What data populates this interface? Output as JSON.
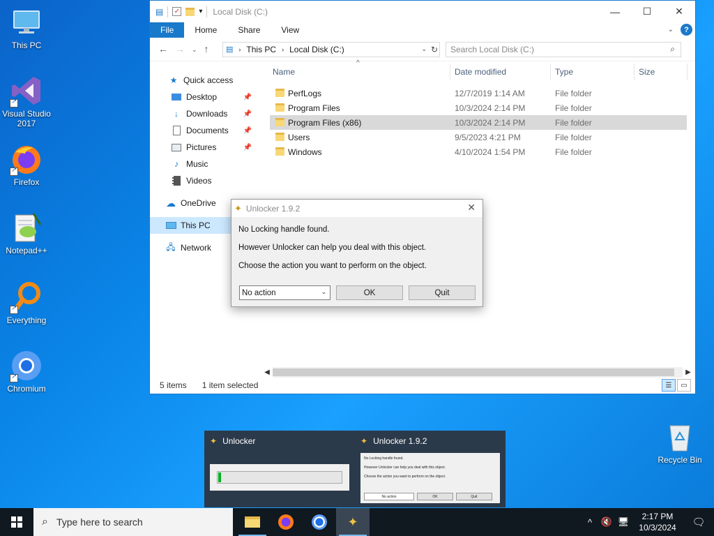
{
  "desktop": {
    "icons": [
      {
        "label": "This PC"
      },
      {
        "label": "Visual Studio 2017"
      },
      {
        "label": "Firefox"
      },
      {
        "label": "Notepad++"
      },
      {
        "label": "Everything"
      },
      {
        "label": "Chromium"
      },
      {
        "label": "Recycle Bin"
      }
    ]
  },
  "explorer": {
    "title": "Local Disk (C:)",
    "ribbon": {
      "file": "File",
      "home": "Home",
      "share": "Share",
      "view": "View",
      "help": "?"
    },
    "address": {
      "root": "This PC",
      "current": "Local Disk (C:)"
    },
    "search_placeholder": "Search Local Disk (C:)",
    "nav": [
      {
        "label": "Quick access"
      },
      {
        "label": "Desktop"
      },
      {
        "label": "Downloads"
      },
      {
        "label": "Documents"
      },
      {
        "label": "Pictures"
      },
      {
        "label": "Music"
      },
      {
        "label": "Videos"
      },
      {
        "label": "OneDrive"
      },
      {
        "label": "This PC"
      },
      {
        "label": "Network"
      }
    ],
    "columns": {
      "name": "Name",
      "date": "Date modified",
      "type": "Type",
      "size": "Size"
    },
    "rows": [
      {
        "name": "PerfLogs",
        "date": "12/7/2019 1:14 AM",
        "type": "File folder"
      },
      {
        "name": "Program Files",
        "date": "10/3/2024 2:14 PM",
        "type": "File folder"
      },
      {
        "name": "Program Files (x86)",
        "date": "10/3/2024 2:14 PM",
        "type": "File folder"
      },
      {
        "name": "Users",
        "date": "9/5/2023 4:21 PM",
        "type": "File folder"
      },
      {
        "name": "Windows",
        "date": "4/10/2024 1:54 PM",
        "type": "File folder"
      }
    ],
    "status": {
      "items": "5 items",
      "selected": "1 item selected"
    }
  },
  "dialog": {
    "title": "Unlocker 1.9.2",
    "line1": "No Locking handle found.",
    "line2": "However Unlocker can help you deal with this object.",
    "line3": "Choose the action you want to perform on the object.",
    "action_selected": "No action",
    "ok": "OK",
    "quit": "Quit"
  },
  "preview": {
    "card1_title": "Unlocker",
    "card2_title": "Unlocker 1.9.2",
    "progress": 0.02
  },
  "taskbar": {
    "search_placeholder": "Type here to search",
    "time": "2:17 PM",
    "date": "10/3/2024"
  },
  "colors": {
    "accent": "#1979ca",
    "selection": "#cce8ff",
    "taskbar": "#101820"
  }
}
